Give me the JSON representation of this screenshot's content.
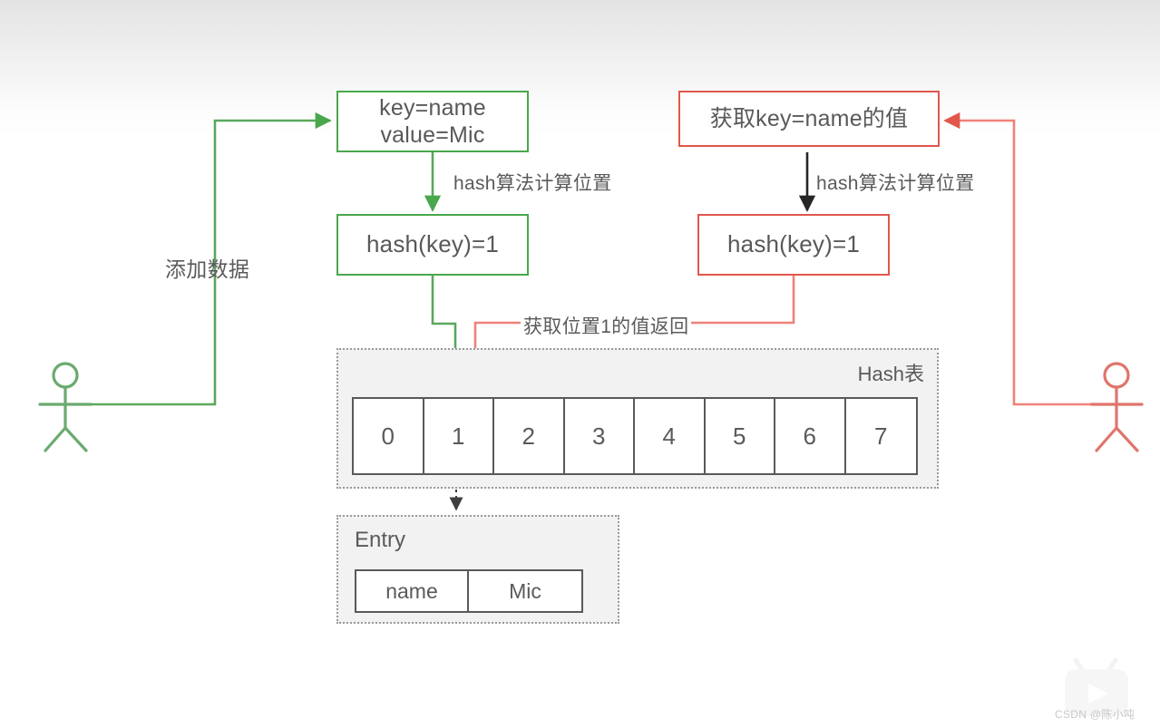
{
  "diagram": {
    "title": "HashMap put and get flow",
    "colors": {
      "green": "#49a74c",
      "red": "#e1574c",
      "dark_text": "#5a5a5a",
      "table_border": "#595959",
      "container_fill": "#f2f2f2",
      "container_border": "#9a9a9a",
      "black_arrow": "#262626"
    }
  },
  "put_flow": {
    "actor_label": "",
    "edge_label": "添加数据",
    "input_node": {
      "line1": "key=name",
      "line2": "value=Mic"
    },
    "hash_edge_label": "hash算法计算位置",
    "hash_node": "hash(key)=1"
  },
  "get_flow": {
    "actor_label": "",
    "request_node": "获取key=name的值",
    "hash_edge_label": "hash算法计算位置",
    "hash_node": "hash(key)=1",
    "return_edge_label": "获取位置1的值返回"
  },
  "hash_table": {
    "title": "Hash表",
    "cells": [
      "0",
      "1",
      "2",
      "3",
      "4",
      "5",
      "6",
      "7"
    ]
  },
  "entry": {
    "title": "Entry",
    "key": "name",
    "value": "Mic"
  },
  "watermark": {
    "text": "CSDN @陈小吨",
    "icon": "play-tv-icon"
  }
}
